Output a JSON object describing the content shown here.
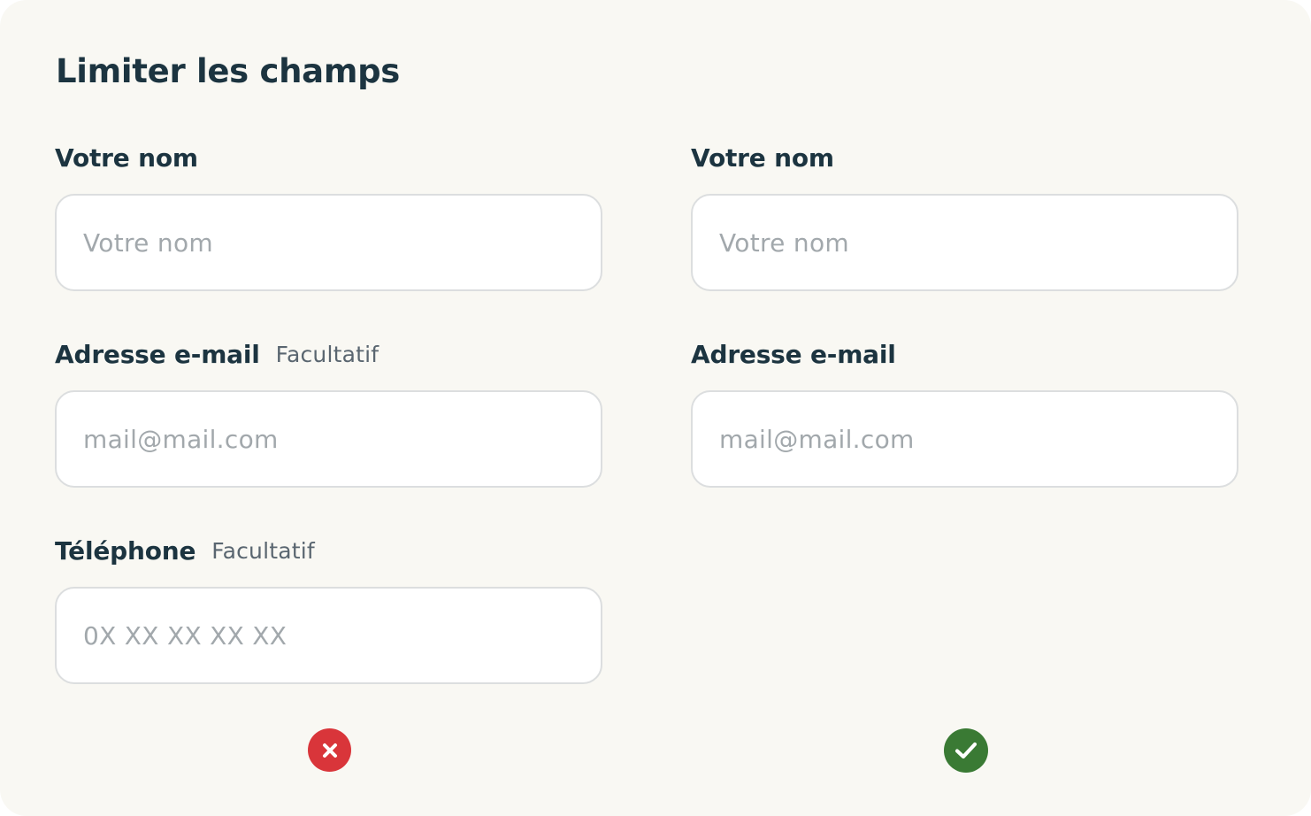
{
  "page": {
    "title": "Limiter les champs"
  },
  "bad_form": {
    "fields": [
      {
        "label": "Votre nom",
        "optional": "",
        "placeholder": "Votre nom"
      },
      {
        "label": "Adresse e-mail",
        "optional": "Facultatif",
        "placeholder": "mail@mail.com"
      },
      {
        "label": "Téléphone",
        "optional": "Facultatif",
        "placeholder": "0X XX XX XX XX"
      }
    ],
    "status_icon": "cross-icon",
    "status_color": "#d9353a"
  },
  "good_form": {
    "fields": [
      {
        "label": "Votre nom",
        "placeholder": "Votre nom"
      },
      {
        "label": "Adresse e-mail",
        "placeholder": "mail@mail.com"
      }
    ],
    "status_icon": "check-icon",
    "status_color": "#3a7a34"
  },
  "colors": {
    "background": "#f9f8f3",
    "heading": "#1c3440",
    "input_border": "#dcdedf",
    "placeholder": "#a2a8ac"
  }
}
